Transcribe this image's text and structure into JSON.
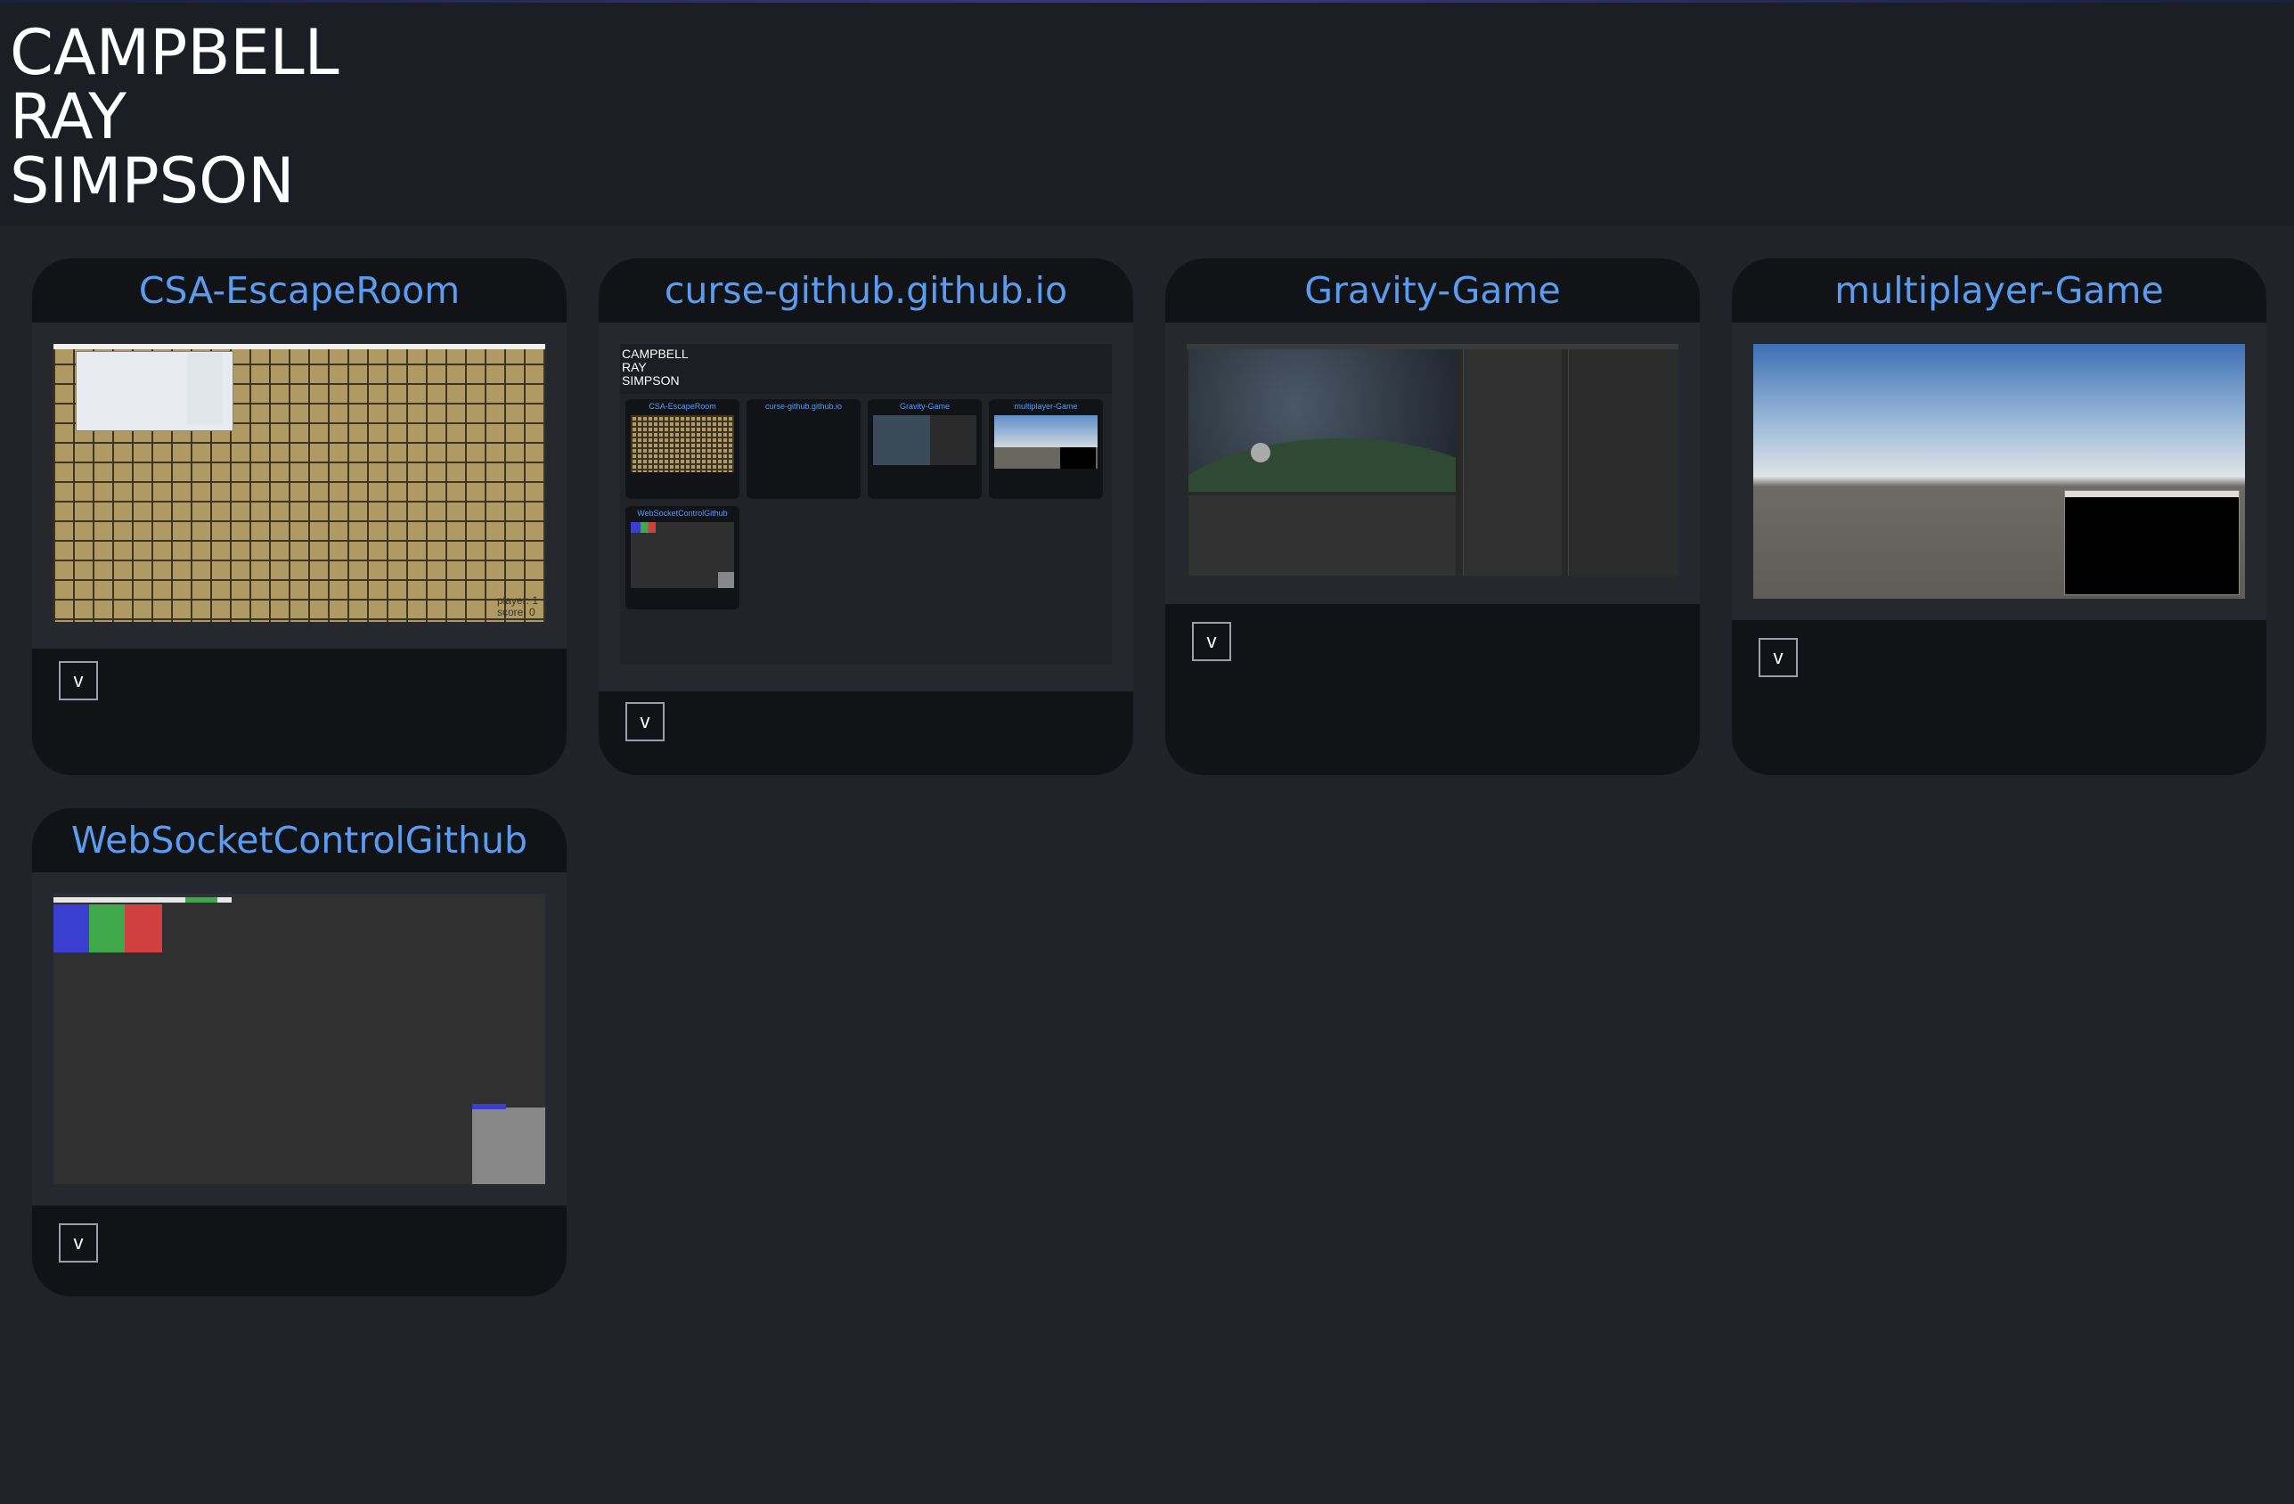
{
  "header": {
    "name_lines": [
      "CAMPBELL",
      "RAY",
      "SIMPSON"
    ]
  },
  "colors": {
    "background": "#202327",
    "header_bg": "#1b1e22",
    "card_bg": "#111317",
    "link": "#5a9cf0"
  },
  "projects": [
    {
      "title": "CSA-EscapeRoom",
      "toggle_label": "v",
      "preview": "escape-room-grid-screenshot"
    },
    {
      "title": "curse-github.github.io",
      "toggle_label": "v",
      "preview": "portfolio-page-screenshot"
    },
    {
      "title": "Gravity-Game",
      "toggle_label": "v",
      "preview": "unity-editor-screenshot"
    },
    {
      "title": "multiplayer-Game",
      "toggle_label": "v",
      "preview": "sky-and-console-screenshot"
    },
    {
      "title": "WebSocketControlGithub",
      "toggle_label": "v",
      "preview": "control-pad-screenshot"
    }
  ],
  "mini_preview": {
    "name_lines": [
      "CAMPBELL",
      "RAY",
      "SIMPSON"
    ],
    "cards": [
      "CSA-EscapeRoom",
      "curse-github.github.io",
      "Gravity-Game",
      "multiplayer-Game",
      "WebSocketControlGithub"
    ]
  },
  "escape_room_hud": {
    "player": "player: 1",
    "score": "score: 0"
  }
}
